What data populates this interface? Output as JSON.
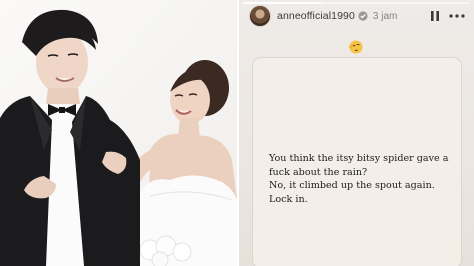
{
  "story": {
    "username": "anneofficial1990",
    "time": "3 jam",
    "icons": {
      "verified": "verified-badge-icon",
      "pause": "pause-icon",
      "more": "more-dots-icon",
      "emoji": "face-emoji-icon"
    },
    "lines": [
      "You think the itsy bitsy spider gave a",
      "fuck about the rain?",
      "No, it climbed up the spout again.",
      "Lock in."
    ]
  },
  "colors": {
    "story_background": "#ebe6e2",
    "card_background": "#f4eee9",
    "verified_blue": "#3897f0"
  }
}
